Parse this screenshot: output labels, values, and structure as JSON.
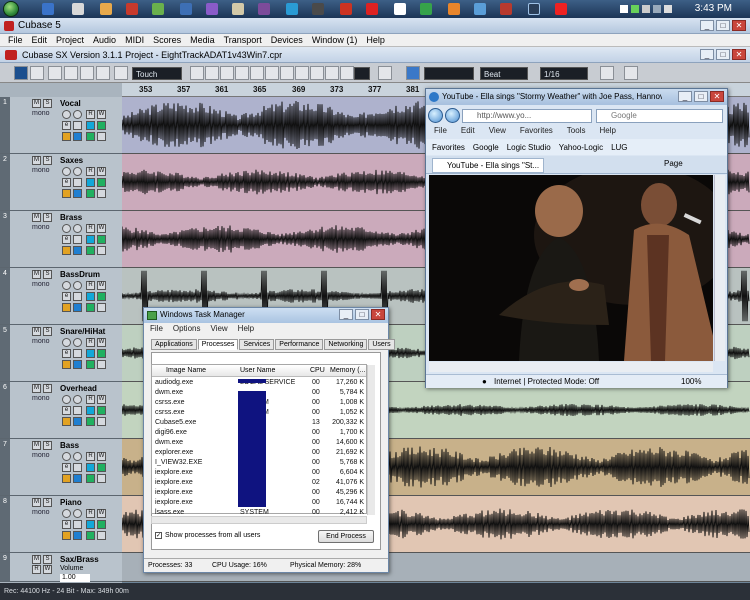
{
  "taskbar": {
    "clock": "3:43 PM"
  },
  "app": {
    "title": "Cubase 5",
    "menu": [
      "File",
      "Edit",
      "Project",
      "Audio",
      "MIDI",
      "Scores",
      "Media",
      "Transport",
      "Devices",
      "Window (1)",
      "Help"
    ],
    "project_title": "Cubase SX Version 3.1.1 Project - EightTrackADAT1v43Win7.cpr",
    "toolbar": {
      "automation_mode": "Touch",
      "snap_type": "Beat",
      "quantize": "1/16"
    },
    "ruler": [
      "353",
      "357",
      "361",
      "365",
      "369",
      "373",
      "377",
      "381"
    ],
    "tracks": [
      {
        "num": "1",
        "name": "Vocal",
        "mono": "mono",
        "color": "#aeb2cd"
      },
      {
        "num": "2",
        "name": "Saxes",
        "mono": "mono",
        "color": "#cbaabb"
      },
      {
        "num": "3",
        "name": "Brass",
        "mono": "mono",
        "color": "#cbaabb"
      },
      {
        "num": "4",
        "name": "BassDrum",
        "mono": "mono",
        "color": "#b9c2c0"
      },
      {
        "num": "5",
        "name": "Snare/HiHat",
        "mono": "mono",
        "color": "#bed0c0"
      },
      {
        "num": "6",
        "name": "Overhead",
        "mono": "mono",
        "color": "#c2d4bf"
      },
      {
        "num": "7",
        "name": "Bass",
        "mono": "mono",
        "color": "#c8b18a"
      },
      {
        "num": "8",
        "name": "Piano",
        "mono": "mono",
        "color": "#e1c6b3"
      },
      {
        "num": "9",
        "name": "Sax/Brass",
        "mono": "",
        "color": "#a7b0b8"
      }
    ],
    "folder_volume": {
      "label": "Volume",
      "value": "1.00"
    },
    "status_bar": "Rec: 44100 Hz - 24 Bit - Max: 349h 00m"
  },
  "ie": {
    "title": "YouTube - Ella sings \"Stormy Weather\" with Joe Pass, Hannover 1975 - ...",
    "address": "http://www.yo...",
    "search_placeholder": "Google",
    "menu": [
      "File",
      "Edit",
      "View",
      "Favorites",
      "Tools",
      "Help"
    ],
    "favorites": [
      "Favorites",
      "Google",
      "Logic Studio",
      "Yahoo-Logic",
      "LUG"
    ],
    "tab": "YouTube - Ella sings \"St...",
    "page_btn": "Page",
    "status_zone": "Internet | Protected Mode: Off",
    "zoom": "100%"
  },
  "taskmgr": {
    "title": "Windows Task Manager",
    "menu": [
      "File",
      "Options",
      "View",
      "Help"
    ],
    "tabs": [
      "Applications",
      "Processes",
      "Services",
      "Performance",
      "Networking",
      "Users"
    ],
    "active_tab": "Processes",
    "columns": [
      "Image Name",
      "User Name",
      "CPU",
      "Memory (..."
    ],
    "rows": [
      {
        "name": "audiodg.exe",
        "user": "LOCAL SERVICE",
        "cpu": "00",
        "mem": "17,260 K"
      },
      {
        "name": "dwm.exe",
        "user": "",
        "cpu": "00",
        "mem": "5,784 K"
      },
      {
        "name": "csrss.exe",
        "user": "SYSTEM",
        "cpu": "00",
        "mem": "1,008 K"
      },
      {
        "name": "csrss.exe",
        "user": "SYSTEM",
        "cpu": "00",
        "mem": "1,052 K"
      },
      {
        "name": "Cubase5.exe",
        "user": "",
        "cpu": "13",
        "mem": "200,332 K"
      },
      {
        "name": "digi96.exe",
        "user": "",
        "cpu": "00",
        "mem": "1,700 K"
      },
      {
        "name": "dwm.exe",
        "user": "",
        "cpu": "00",
        "mem": "14,600 K"
      },
      {
        "name": "explorer.exe",
        "user": "",
        "cpu": "00",
        "mem": "21,692 K"
      },
      {
        "name": "I_VIEW32.EXE",
        "user": "",
        "cpu": "00",
        "mem": "5,768 K"
      },
      {
        "name": "iexplore.exe",
        "user": "",
        "cpu": "00",
        "mem": "6,604 K"
      },
      {
        "name": "iexplore.exe",
        "user": "",
        "cpu": "02",
        "mem": "41,076 K"
      },
      {
        "name": "iexplore.exe",
        "user": "",
        "cpu": "00",
        "mem": "45,296 K"
      },
      {
        "name": "iexplore.exe",
        "user": "",
        "cpu": "00",
        "mem": "16,744 K"
      },
      {
        "name": "lsass.exe",
        "user": "SYSTEM",
        "cpu": "00",
        "mem": "2,412 K"
      }
    ],
    "show_all_label": "Show processes from all users",
    "end_process": "End Process",
    "status": {
      "processes": "Processes: 33",
      "cpu": "CPU Usage: 16%",
      "memory": "Physical Memory: 28%"
    }
  }
}
